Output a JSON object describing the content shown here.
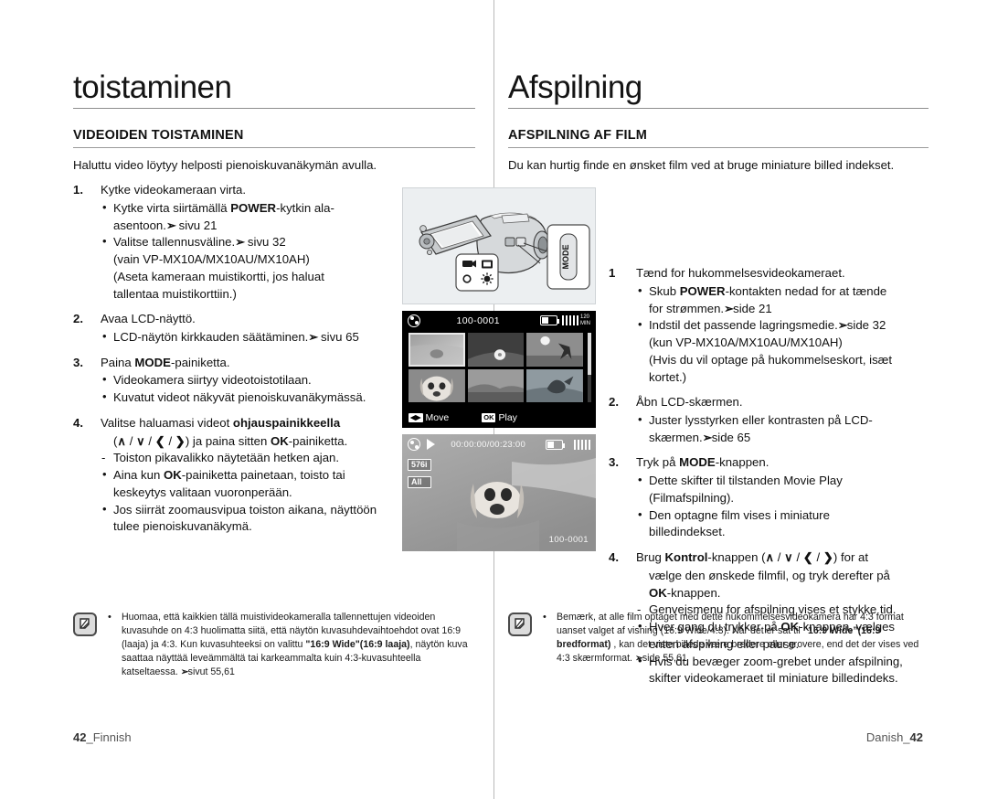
{
  "left": {
    "chapter_title": "toistaminen",
    "section_title": "VIDEOIDEN TOISTAMINEN",
    "intro": "Haluttu video löytyy helposti pienoiskuvanäkymän avulla.",
    "steps": [
      {
        "num": "1.",
        "title": "Kytke videokameraan virta.",
        "lines": [
          {
            "kind": "bullet",
            "html": "Kytke virta siirtämällä <b>POWER</b>-kytkin ala-"
          },
          {
            "kind": "plain",
            "html": "asentoon.<span class=\"arrow\">&#10146;</span> sivu 21"
          },
          {
            "kind": "bullet",
            "html": "Valitse tallennusväline.<span class=\"arrow\">&#10146;</span> sivu 32"
          },
          {
            "kind": "plain",
            "html": "(vain VP-MX10A/MX10AU/MX10AH)"
          },
          {
            "kind": "plain",
            "html": "(Aseta kameraan muistikortti, jos haluat"
          },
          {
            "kind": "plain",
            "html": "tallentaa muistikorttiin.)"
          }
        ]
      },
      {
        "num": "2.",
        "title": "Avaa LCD-näyttö.",
        "lines": [
          {
            "kind": "bullet",
            "html": "LCD-näytön kirkkauden säätäminen.<span class=\"arrow\">&#10146;</span> sivu 65"
          }
        ]
      },
      {
        "num": "3.",
        "title": "Paina <b>MODE</b>-painiketta.",
        "lines": [
          {
            "kind": "bullet",
            "html": "Videokamera siirtyy videotoistotilaan."
          },
          {
            "kind": "bullet",
            "html": "Kuvatut videot näkyvät pienoiskuvanäkymässä."
          }
        ]
      },
      {
        "num": "4.",
        "title": "Valitse haluamasi videot <b>ohjauspainikkeella</b>",
        "lines": [
          {
            "kind": "plain",
            "html": "(<b>&#8743;</b> / <b>&#8744;</b> / <b>&#10094;</b> / <b>&#10095;</b>) ja paina sitten <b>OK</b>-painiketta."
          },
          {
            "kind": "dash",
            "html": "Toiston pikavalikko näytetään hetken ajan."
          },
          {
            "kind": "bullet",
            "html": "Aina kun <b>OK</b>-painiketta painetaan, toisto tai"
          },
          {
            "kind": "plain",
            "html": "keskeytys valitaan vuoronperään."
          },
          {
            "kind": "bullet",
            "html": "Jos siirrät zoomausvipua toiston aikana, näyttöön"
          },
          {
            "kind": "plain",
            "html": "tulee pienoiskuvanäkymä."
          }
        ]
      }
    ],
    "note": "Huomaa, että kaikkien tällä muistivideokameralla tallennettujen videoiden kuvasuhde on 4:3 huolimatta siitä, että näytön kuvasuhdevaihtoehdot ovat 16:9 (laaja) ja 4:3. Kun kuvasuhteeksi on valittu <b>\"16:9 Wide\"(16:9 laaja)</b>, näytön kuva saattaa näyttää leveämmältä tai karkeammalta kuin 4:3-kuvasuhteella katseltaessa. <span class=\"arrow\">&#10146;</span>sivut 55,61",
    "footer_page": "42",
    "footer_lang": "Finnish"
  },
  "right": {
    "chapter_title": "Afspilning",
    "section_title": "AFSPILNING AF FILM",
    "intro": "Du kan hurtig finde en ønsket film ved at bruge miniature billed indekset.",
    "steps": [
      {
        "num": "1",
        "title": "Tænd for hukommelsesvideokameraet.",
        "lines": [
          {
            "kind": "bullet",
            "html": "Skub <b>POWER</b>-kontakten nedad for at tænde"
          },
          {
            "kind": "plain",
            "html": "for strømmen.<span class=\"arrow\">&#10146;</span>side 21"
          },
          {
            "kind": "bullet",
            "html": "Indstil det passende lagringsmedie.<span class=\"arrow\">&#10146;</span>side 32"
          },
          {
            "kind": "plain",
            "html": "(kun VP-MX10A/MX10AU/MX10AH)"
          },
          {
            "kind": "plain",
            "html": "(Hvis du vil optage på hukommelseskort, isæt"
          },
          {
            "kind": "plain",
            "html": "kortet.)"
          }
        ]
      },
      {
        "num": "2.",
        "title": "Åbn LCD-skærmen.",
        "lines": [
          {
            "kind": "bullet",
            "html": "Juster lysstyrken eller kontrasten på LCD-"
          },
          {
            "kind": "plain",
            "html": "skærmen.<span class=\"arrow\">&#10146;</span>side 65"
          }
        ]
      },
      {
        "num": "3.",
        "title": "Tryk på <b>MODE</b>-knappen.",
        "lines": [
          {
            "kind": "bullet",
            "html": "Dette skifter til tilstanden Movie Play"
          },
          {
            "kind": "plain",
            "html": "(Filmafspilning)."
          },
          {
            "kind": "bullet",
            "html": "Den optagne film vises i miniature"
          },
          {
            "kind": "plain",
            "html": "billedindekset."
          }
        ]
      },
      {
        "num": "4.",
        "title": "Brug <b>Kontrol</b>-knappen (<b>&#8743;</b> / <b>&#8744;</b> / <b>&#10094;</b> / <b>&#10095;</b>) for at",
        "lines": [
          {
            "kind": "plain",
            "html": "vælge den ønskede filmfil, og tryk derefter på"
          },
          {
            "kind": "plain",
            "html": "<b>OK</b>-knappen."
          },
          {
            "kind": "dash",
            "html": "Genvejsmenu for afspilning vises et stykke tid."
          },
          {
            "kind": "bullet",
            "html": "Hver gang du trykker på <b>OK</b>-knappen, vælges"
          },
          {
            "kind": "plain",
            "html": "enten afspilning eller pause."
          },
          {
            "kind": "bullet",
            "html": "Hvis du bevæger zoom-grebet under afspilning,"
          },
          {
            "kind": "plain",
            "html": "skifter videokameraet til miniature billedindeks."
          }
        ]
      }
    ],
    "note": "Bemærk, at alle film optaget med dette hukommelsesvideokamera har 4:3 format uanset valget af visning (16:9 Wide/4:3). Når det er sat til <b>&#8220;16:9 Wide&#8221;(16:9 bredformat)</b> , kan det viste billede være bredere eller grovere, end det der vises ved 4:3 skærmformat. <span class=\"arrow\">&#10146;</span>side 55,61",
    "footer_page": "42",
    "footer_lang": "Danish"
  },
  "figures": {
    "camcorder": {
      "mode_label": "MODE",
      "callout_icons": [
        "movie-camera-icon",
        "photo-playback-icon",
        "record-dot-icon",
        "sun-icon"
      ]
    },
    "thumbnail_screen": {
      "file_number": "100-0001",
      "battery_icon": "battery-icon",
      "mode_icon": "film-reel-icon",
      "time_label": "120 MIN",
      "move_key": "ctrl",
      "move_label": "Move",
      "play_key": "OK",
      "play_label": "Play",
      "thumbnails": [
        "thumb-1",
        "thumb-2",
        "thumb-3",
        "thumb-4",
        "thumb-5",
        "thumb-6"
      ]
    },
    "playback_screen": {
      "mode_icon": "film-reel-icon",
      "play_icon": "play-icon",
      "timecode": "00:00:00/00:23:00",
      "quality_badge": "576i",
      "repeat_badge": "All",
      "file_number": "100-0001",
      "battery_icon": "battery-icon"
    }
  }
}
